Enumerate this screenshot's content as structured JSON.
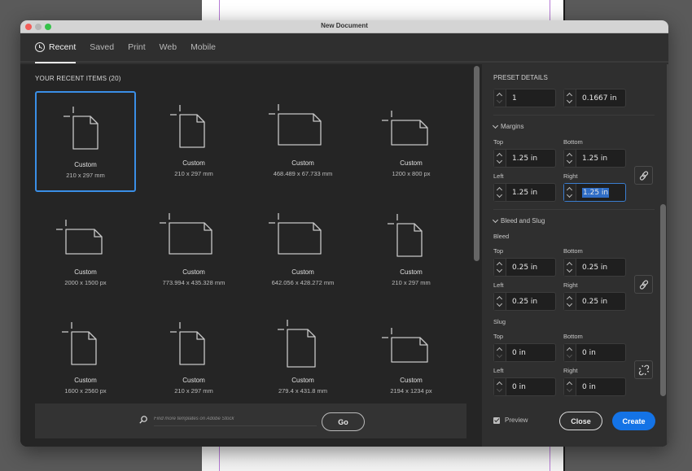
{
  "window": {
    "title": "New Document"
  },
  "tabs": [
    {
      "label": "Recent",
      "icon": "clock-icon",
      "active": true
    },
    {
      "label": "Saved",
      "active": false
    },
    {
      "label": "Print",
      "active": false
    },
    {
      "label": "Web",
      "active": false
    },
    {
      "label": "Mobile",
      "active": false
    }
  ],
  "recent": {
    "heading": "YOUR RECENT ITEMS  (20)",
    "items": [
      {
        "name": "Custom",
        "size": "210 x 297 mm",
        "orientation": "portrait",
        "selected": true
      },
      {
        "name": "Custom",
        "size": "210 x 297 mm",
        "orientation": "portrait"
      },
      {
        "name": "Custom",
        "size": "468.489 x 67.733 mm",
        "orientation": "landscape-large"
      },
      {
        "name": "Custom",
        "size": "1200 x 800 px",
        "orientation": "landscape"
      },
      {
        "name": "Custom",
        "size": "2000 x 1500 px",
        "orientation": "landscape"
      },
      {
        "name": "Custom",
        "size": "773.994 x 435.328 mm",
        "orientation": "landscape-large"
      },
      {
        "name": "Custom",
        "size": "642.056 x 428.272 mm",
        "orientation": "landscape-large"
      },
      {
        "name": "Custom",
        "size": "210 x 297 mm",
        "orientation": "portrait"
      },
      {
        "name": "Custom",
        "size": "1600 x 2560 px",
        "orientation": "portrait"
      },
      {
        "name": "Custom",
        "size": "210 x 297 mm",
        "orientation": "portrait"
      },
      {
        "name": "Custom",
        "size": "279.4 x 431.8 mm",
        "orientation": "portrait-large"
      },
      {
        "name": "Custom",
        "size": "2194 x 1234 px",
        "orientation": "landscape"
      }
    ]
  },
  "search": {
    "placeholder": "Find more templates on Adobe Stock",
    "go_label": "Go"
  },
  "preset": {
    "heading": "PRESET DETAILS",
    "columns_value": "1",
    "gutter_value": "0.1667 in",
    "margins": {
      "label": "Margins",
      "top_label": "Top",
      "top": "1.25 in",
      "bottom_label": "Bottom",
      "bottom": "1.25 in",
      "left_label": "Left",
      "left": "1.25 in",
      "right_label": "Right",
      "right": "1.25 in"
    },
    "bleed_slug": {
      "label": "Bleed and Slug",
      "bleed": {
        "label": "Bleed",
        "top_label": "Top",
        "top": "0.25 in",
        "bottom_label": "Bottom",
        "bottom": "0.25 in",
        "left_label": "Left",
        "left": "0.25 in",
        "right_label": "Right",
        "right": "0.25 in"
      },
      "slug": {
        "label": "Slug",
        "top_label": "Top",
        "top": "0 in",
        "bottom_label": "Bottom",
        "bottom": "0 in",
        "left_label": "Left",
        "left": "0 in",
        "right_label": "Right",
        "right": "0 in"
      }
    }
  },
  "footer": {
    "preview_label": "Preview",
    "preview_checked": true,
    "close_label": "Close",
    "create_label": "Create"
  },
  "colors": {
    "accent": "#1473e6",
    "selection_border": "#3a8ee6"
  }
}
